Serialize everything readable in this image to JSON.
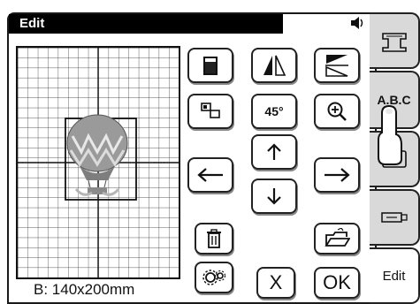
{
  "window": {
    "title": "Edit"
  },
  "status": {
    "speaker_icon": "speaker-icon"
  },
  "preview": {
    "size_label": "B: 140x200mm"
  },
  "buttons": {
    "cancel_label": "X",
    "ok_label": "OK",
    "angle_label": "45°"
  },
  "tabs": [
    {
      "name": "sewing-machine",
      "icon": "sewing-machine-icon"
    },
    {
      "name": "character",
      "label": "A.B.C"
    },
    {
      "name": "embroidery",
      "icon": "embroidery-icon"
    },
    {
      "name": "memory",
      "icon": "usb-icon"
    },
    {
      "name": "edit",
      "label": "Edit",
      "active": true
    }
  ],
  "colors": {
    "title_bg": "#000000",
    "tab_bg": "#d9d9d9",
    "panel_bg": "#ffffff"
  }
}
